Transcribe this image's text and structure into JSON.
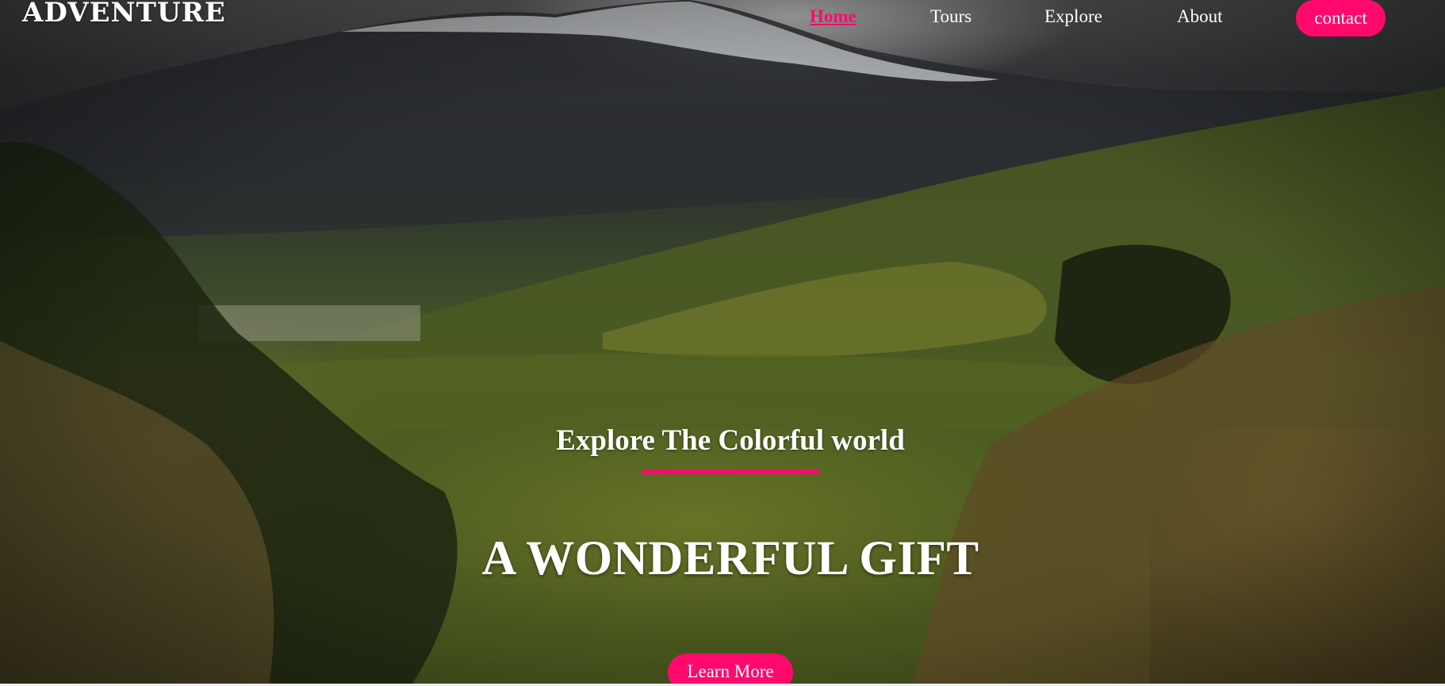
{
  "brand": {
    "logo_text": "ADVENTURE"
  },
  "nav": {
    "items": [
      {
        "label": "Home",
        "active": true
      },
      {
        "label": "Tours",
        "active": false
      },
      {
        "label": "Explore",
        "active": false
      },
      {
        "label": "About",
        "active": false
      }
    ],
    "contact_label": "contact"
  },
  "hero": {
    "subtitle": "Explore The Colorful world",
    "headline": "A WONDERFUL GIFT",
    "cta_label": "Learn More"
  },
  "colors": {
    "accent": "#ff0a6c",
    "text": "#ffffff"
  }
}
